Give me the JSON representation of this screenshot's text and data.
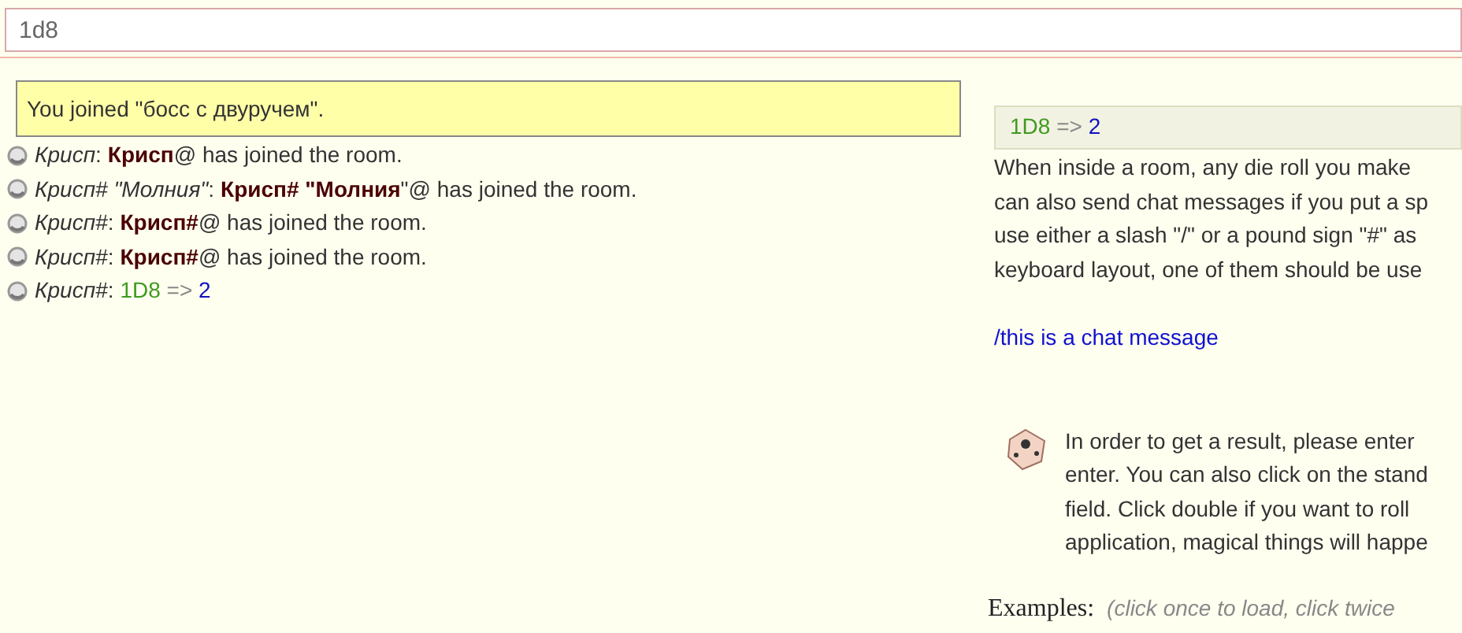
{
  "input": {
    "value": "1d8"
  },
  "notice": "You joined \"босс с двуручем\".",
  "separator": ":",
  "log": [
    {
      "kind": "join",
      "speaker": "Крисп",
      "name": "Крисп",
      "suffix": "@",
      "text": " has joined the room."
    },
    {
      "kind": "join",
      "speaker": "Крисп# \"Молния\"",
      "name": "Крисп# \"Молния",
      "suffix": "\"@",
      "text": " has joined the room."
    },
    {
      "kind": "join",
      "speaker": "Крисп#",
      "name": "Крисп#",
      "suffix": "@",
      "text": " has joined the room."
    },
    {
      "kind": "join",
      "speaker": "Крисп#",
      "name": "Крисп#",
      "suffix": "@",
      "text": " has joined the room."
    },
    {
      "kind": "roll",
      "speaker": "Крисп#",
      "dice": "1D8",
      "arrow": "=>",
      "result": "2"
    }
  ],
  "help": {
    "example_roll": {
      "dice": "1D8",
      "arrow": "=>",
      "result": "2"
    },
    "paragraph_lines": [
      "When inside a room, any die roll you make",
      "can also send chat messages if you put a sp",
      "use either a slash \"/\" or a pound sign \"#\" as",
      "keyboard layout, one of them should be use"
    ],
    "chat_example": "/this is a chat message",
    "tip_lines": [
      "In order to get a result, please enter",
      "enter. You can also click on the stand",
      "field. Click double if you want to roll",
      "application, magical things will happe"
    ],
    "examples_label": "Examples:",
    "examples_hint": "(click once to load, click twice"
  }
}
